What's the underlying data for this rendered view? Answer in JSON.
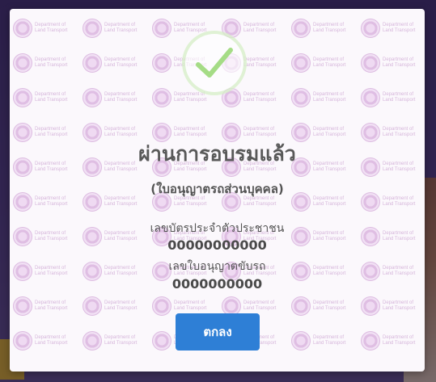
{
  "modal": {
    "title": "ผ่านการอบรมแล้ว",
    "subtitle": "(ใบอนุญาตรถส่วนบุคคล)",
    "id_card_label": "เลขบัตรประจำตัวประชาชน",
    "id_card_value": "00000000000",
    "license_label": "เลขใบอนุญาตขับรถ",
    "license_value": "0000000000",
    "ok_button_label": "ตกลง",
    "icon": "success-checkmark-icon",
    "watermark_text": [
      "Department of",
      "Land Transport"
    ]
  },
  "colors": {
    "accent": "#2e7fd6",
    "success": "#a5dc86",
    "watermark": "#c98fd0"
  }
}
